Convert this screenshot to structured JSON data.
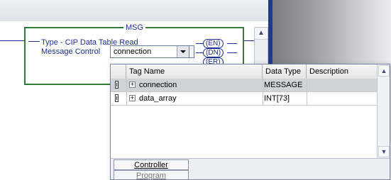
{
  "msg_block": {
    "title": "MSG",
    "type_text": "Type - CIP Data Table Read",
    "message_control_label": "Message Control",
    "message_control_value": "connection",
    "outputs": [
      "EN",
      "DN",
      "ER"
    ]
  },
  "tag_browser": {
    "columns": [
      "Tag Name",
      "Data Type",
      "Description"
    ],
    "rows": [
      {
        "name": "connection",
        "data_type": "MESSAGE",
        "description": "",
        "selected": true
      },
      {
        "name": "data_array",
        "data_type": "INT[73]",
        "description": "",
        "selected": false
      }
    ],
    "scope_tabs": [
      "Controller",
      "Program"
    ],
    "active_tab": "Controller"
  },
  "colors": {
    "accent_blue": "#1a2c9a",
    "block_border_green": "#2f7d32",
    "selected_row": "#cfd3d8"
  }
}
